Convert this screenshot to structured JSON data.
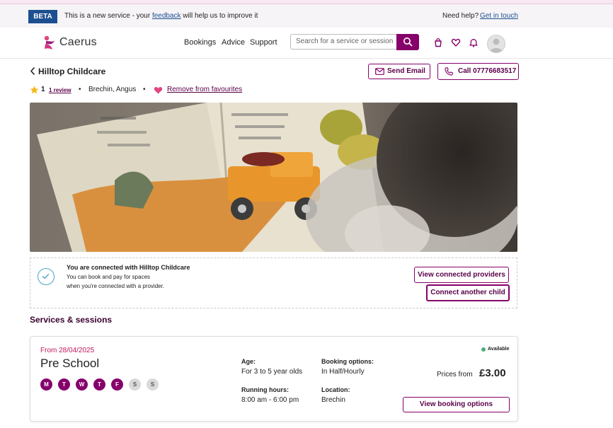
{
  "beta_bar": {
    "tag": "BETA",
    "text_before": "This is a new service - your ",
    "feedback_link": "feedback",
    "text_after": " will help us to improve it",
    "help_text": "Need help?",
    "help_link": "Get in touch"
  },
  "header": {
    "logo_text": "Caerus",
    "nav": [
      "Bookings",
      "Advice",
      "Support"
    ],
    "search_placeholder": "Search for a service or session",
    "icons": [
      "basket-icon",
      "heart-icon",
      "bell-icon",
      "avatar"
    ]
  },
  "provider": {
    "back_label": "Hilltop Childcare",
    "send_email_label": "Send Email",
    "call_label": "Call 07776683517",
    "rating": "1",
    "reviews_link": "1 review",
    "location": "Brechin, Angus",
    "favourite_link": "Remove from favourites",
    "hero_alt": "Child reading a picture book"
  },
  "connection": {
    "title": "You are connected with Hilltop Childcare",
    "line1": "You can book and pay for spaces",
    "line2": "when you're connected with a provider.",
    "view_button": "View connected providers",
    "connect_button": "Connect another child"
  },
  "services": {
    "section_title": "Services & sessions",
    "card": {
      "from_date": "From 28/04/2025",
      "title": "Pre School",
      "days": [
        {
          "letter": "M",
          "active": true
        },
        {
          "letter": "T",
          "active": true
        },
        {
          "letter": "W",
          "active": true
        },
        {
          "letter": "T",
          "active": true
        },
        {
          "letter": "F",
          "active": true
        },
        {
          "letter": "S",
          "active": false
        },
        {
          "letter": "S",
          "active": false
        }
      ],
      "age_label": "Age:",
      "age_value": "For 3 to 5 year olds",
      "hours_label": "Running hours:",
      "hours_value": "8:00 am - 6:00 pm",
      "booking_label": "Booking options:",
      "booking_value": "In Half/Hourly",
      "location_label": "Location:",
      "location_value": "Brechin",
      "availability": "Available",
      "prices_from": "Prices from",
      "price": "£3.00",
      "view_booking_button": "View booking options"
    }
  },
  "colors": {
    "brand_primary": "#86006b",
    "beta_blue": "#1d4f91",
    "available_green": "#4caf7d",
    "date_pink": "#c2185b"
  }
}
